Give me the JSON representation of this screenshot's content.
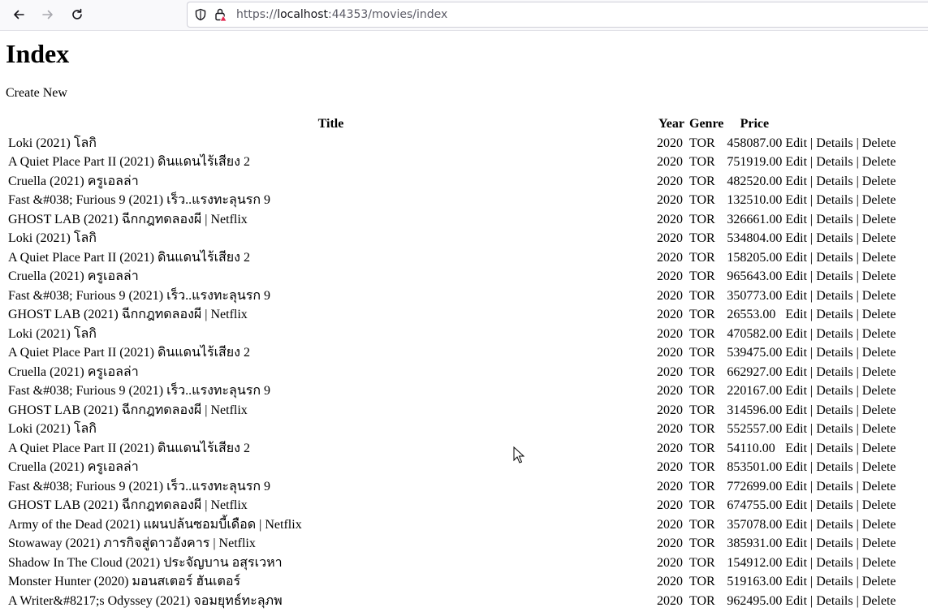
{
  "browser": {
    "url_prefix": "https://",
    "url_host": "localhost",
    "url_rest": ":44353/movies/index"
  },
  "page": {
    "title": "Index",
    "create_new": "Create New"
  },
  "table": {
    "headers": {
      "title": "Title",
      "year": "Year",
      "genre": "Genre",
      "price": "Price"
    },
    "actions": {
      "edit": "Edit",
      "details": "Details",
      "delete": "Delete",
      "sep": " | "
    },
    "rows": [
      {
        "title": "Loki (2021) โลกิ",
        "year": "2020",
        "genre": "TOR",
        "price": "458087.00"
      },
      {
        "title": "A Quiet Place Part II (2021) ดินแดนไร้เสียง 2",
        "year": "2020",
        "genre": "TOR",
        "price": "751919.00"
      },
      {
        "title": "Cruella (2021) ครูเอลล่า",
        "year": "2020",
        "genre": "TOR",
        "price": "482520.00"
      },
      {
        "title": "Fast &#038; Furious 9 (2021) เร็ว..แรงทะลุนรก 9",
        "year": "2020",
        "genre": "TOR",
        "price": "132510.00"
      },
      {
        "title": "GHOST LAB (2021) ฉีกกฎทดลองผี | Netflix",
        "year": "2020",
        "genre": "TOR",
        "price": "326661.00"
      },
      {
        "title": "Loki (2021) โลกิ",
        "year": "2020",
        "genre": "TOR",
        "price": "534804.00"
      },
      {
        "title": "A Quiet Place Part II (2021) ดินแดนไร้เสียง 2",
        "year": "2020",
        "genre": "TOR",
        "price": "158205.00"
      },
      {
        "title": "Cruella (2021) ครูเอลล่า",
        "year": "2020",
        "genre": "TOR",
        "price": "965643.00"
      },
      {
        "title": "Fast &#038; Furious 9 (2021) เร็ว..แรงทะลุนรก 9",
        "year": "2020",
        "genre": "TOR",
        "price": "350773.00"
      },
      {
        "title": "GHOST LAB (2021) ฉีกกฎทดลองผี | Netflix",
        "year": "2020",
        "genre": "TOR",
        "price": "26553.00"
      },
      {
        "title": "Loki (2021) โลกิ",
        "year": "2020",
        "genre": "TOR",
        "price": "470582.00"
      },
      {
        "title": "A Quiet Place Part II (2021) ดินแดนไร้เสียง 2",
        "year": "2020",
        "genre": "TOR",
        "price": "539475.00"
      },
      {
        "title": "Cruella (2021) ครูเอลล่า",
        "year": "2020",
        "genre": "TOR",
        "price": "662927.00"
      },
      {
        "title": "Fast &#038; Furious 9 (2021) เร็ว..แรงทะลุนรก 9",
        "year": "2020",
        "genre": "TOR",
        "price": "220167.00"
      },
      {
        "title": "GHOST LAB (2021) ฉีกกฎทดลองผี | Netflix",
        "year": "2020",
        "genre": "TOR",
        "price": "314596.00"
      },
      {
        "title": "Loki (2021) โลกิ",
        "year": "2020",
        "genre": "TOR",
        "price": "552557.00"
      },
      {
        "title": "A Quiet Place Part II (2021) ดินแดนไร้เสียง 2",
        "year": "2020",
        "genre": "TOR",
        "price": "54110.00"
      },
      {
        "title": "Cruella (2021) ครูเอลล่า",
        "year": "2020",
        "genre": "TOR",
        "price": "853501.00"
      },
      {
        "title": "Fast &#038; Furious 9 (2021) เร็ว..แรงทะลุนรก 9",
        "year": "2020",
        "genre": "TOR",
        "price": "772699.00"
      },
      {
        "title": "GHOST LAB (2021) ฉีกกฎทดลองผี | Netflix",
        "year": "2020",
        "genre": "TOR",
        "price": "674755.00"
      },
      {
        "title": "Army of the Dead (2021) แผนปล้นซอมบี้เดือด | Netflix",
        "year": "2020",
        "genre": "TOR",
        "price": "357078.00"
      },
      {
        "title": "Stowaway (2021) ภารกิจสู่ดาวอังคาร | Netflix",
        "year": "2020",
        "genre": "TOR",
        "price": "385931.00"
      },
      {
        "title": "Shadow In The Cloud (2021) ประจัญบาน อสุรเวหา",
        "year": "2020",
        "genre": "TOR",
        "price": "154912.00"
      },
      {
        "title": "Monster Hunter (2020) มอนสเตอร์ ฮันเตอร์",
        "year": "2020",
        "genre": "TOR",
        "price": "519163.00"
      },
      {
        "title": "A Writer&#8217;s Odyssey (2021) จอมยุทธ์ทะลุภพ",
        "year": "2020",
        "genre": "TOR",
        "price": "962495.00"
      }
    ]
  }
}
